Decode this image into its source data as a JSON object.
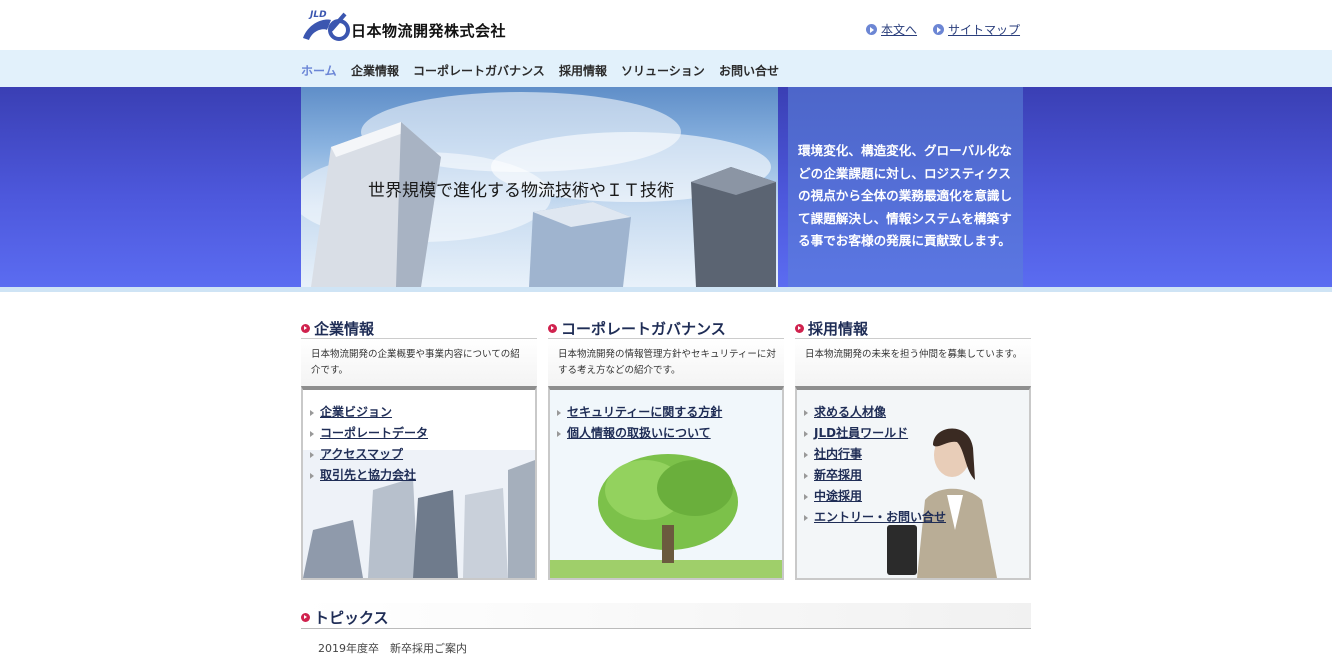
{
  "header": {
    "logo_text": "JLD",
    "company": "日本物流開発株式会社",
    "util_links": [
      "本文へ",
      "サイトマップ"
    ]
  },
  "nav": {
    "items": [
      "ホーム",
      "企業情報",
      "コーポレートガバナンス",
      "採用情報",
      "ソリューション",
      "お問い合せ"
    ],
    "active_color": "#6b86d6"
  },
  "hero": {
    "tagline": "世界規模で進化する物流技術やＩＴ技術",
    "message": "環境変化、構造変化、グローバル化などの企業課題に対し、ロジスティクスの視点から全体の業務最適化を意識して課題解決し、情報システムを構築する事でお客様の発展に貢献致します。"
  },
  "sections": [
    {
      "title": "企業情報",
      "desc": "日本物流開発の企業概要や事業内容についての紹介です。",
      "links": [
        "企業ビジョン",
        "コーポレートデータ",
        "アクセスマップ",
        "取引先と協力会社"
      ]
    },
    {
      "title": "コーポレートガバナンス",
      "desc": "日本物流開発の情報管理方針やセキュリティーに対する考え方などの紹介です。",
      "links": [
        "セキュリティーに関する方針",
        "個人情報の取扱いについて"
      ]
    },
    {
      "title": "採用情報",
      "desc": "日本物流開発の未来を担う仲間を募集しています。",
      "links": [
        "求める人材像",
        "JLD社員ワールド",
        "社内行事",
        "新卒採用",
        "中途採用",
        "エントリー・お問い合せ"
      ]
    }
  ],
  "topics": {
    "title": "トピックス",
    "first_item": "2019年度卒　新卒採用ご案内"
  },
  "colors": {
    "accent_red": "#d0224e",
    "nav_bg": "#e2f1fb",
    "hero_blue": "#4d58dc"
  }
}
